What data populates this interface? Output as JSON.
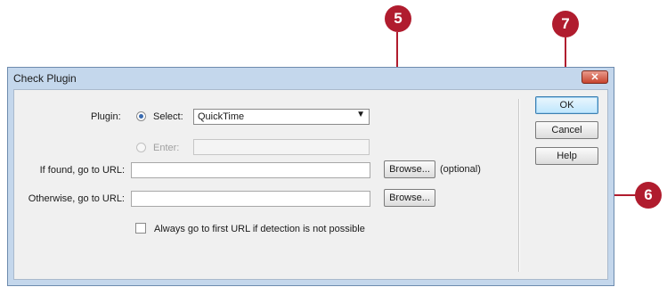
{
  "callouts": {
    "c5": "5",
    "c6": "6",
    "c7": "7"
  },
  "dialog": {
    "title": "Check Plugin",
    "close_glyph": "✕",
    "plugin_label": "Plugin:",
    "select_radio_label": "Select:",
    "select_value": "QuickTime",
    "enter_radio_label": "Enter:",
    "enter_value": "",
    "if_found_label": "If found, go to URL:",
    "if_found_value": "",
    "browse_label": "Browse...",
    "optional_label": "(optional)",
    "otherwise_label": "Otherwise, go to URL:",
    "otherwise_value": "",
    "always_go_label": "Always go to first URL if detection is not possible",
    "ok_label": "OK",
    "cancel_label": "Cancel",
    "help_label": "Help"
  },
  "colors": {
    "callout": "#b01c2e",
    "frame": "#c4d7ec"
  }
}
